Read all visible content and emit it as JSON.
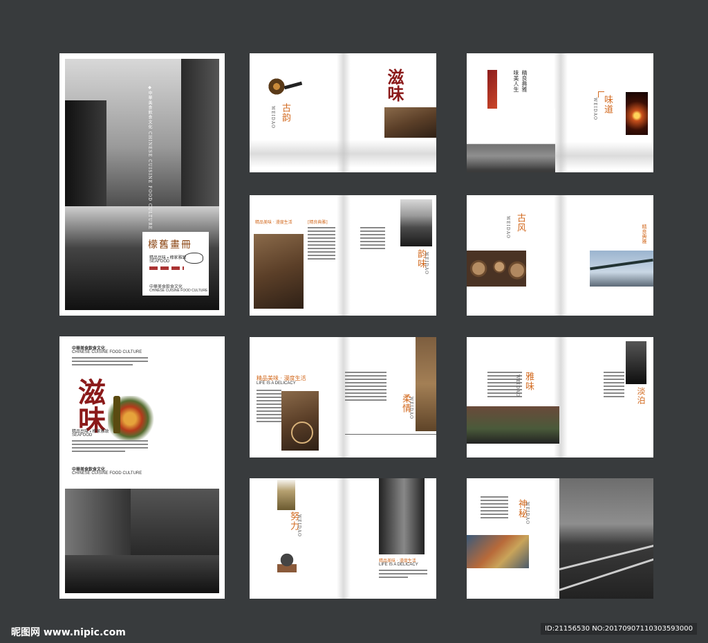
{
  "cover": {
    "title": "檬舊畫冊",
    "vertical_caption": "◆中華美食飲食文化 CHINESE CUISINE FOOD CULTURE",
    "sub1": "精品豆味 ▪ 檬家雅致",
    "sub2": "SEAFOOD",
    "culture_cn": "中華美食飲食文化",
    "culture_en": "CHINESE CUISINE FOOD CULTURE"
  },
  "back_page": {
    "culture_cn": "中華美食飲食文化",
    "culture_en": "CHINESE CUISINE FOOD CULTURE",
    "calligraphy": "滋味",
    "sub1": "精品豆味 ▪ 檬家雅致",
    "sub2": "SEAFOOD",
    "culture_cn2": "中華美食飲食文化",
    "culture_en2": "CHINESE CUISINE FOOD CULTURE"
  },
  "spreads": {
    "s1": {
      "vertical": "古韵",
      "pinyin": "WEIDAO",
      "calligraphy": "滋味"
    },
    "s2": {
      "vertical": "味道",
      "pinyin": "WEIDAO",
      "top_v": "精良典雅",
      "top_v2": "味美人生"
    },
    "s3": {
      "head1": "精品美味 · 漫度生活",
      "head2": "[精良典雅]",
      "vertical": "韵味",
      "pinyin": "WEIDAO"
    },
    "s4": {
      "vertical": "古风",
      "pinyin": "WEIDAO",
      "top_v": "精良典雅"
    },
    "s5": {
      "head1": "精品美味 · 漫度生活",
      "head_en": "LIFE IS A DELICACY",
      "vertical": "柔情",
      "pinyin": "WEIDAO"
    },
    "s6": {
      "vertical": "雅味",
      "pinyin": "WEIDAO",
      "vertical2": "淡泊"
    },
    "s7": {
      "vertical": "努力",
      "pinyin": "WEIDAO",
      "head1": "精品美味 · 漫度生活",
      "head_en": "LIFE IS A DELICACY"
    },
    "s8": {
      "vertical": "神秘",
      "pinyin": "WEIDAO"
    }
  },
  "footer": {
    "logo": "昵图网 www.nipic.com",
    "id_text": "ID:21156530 NO:20170907110303593000"
  }
}
